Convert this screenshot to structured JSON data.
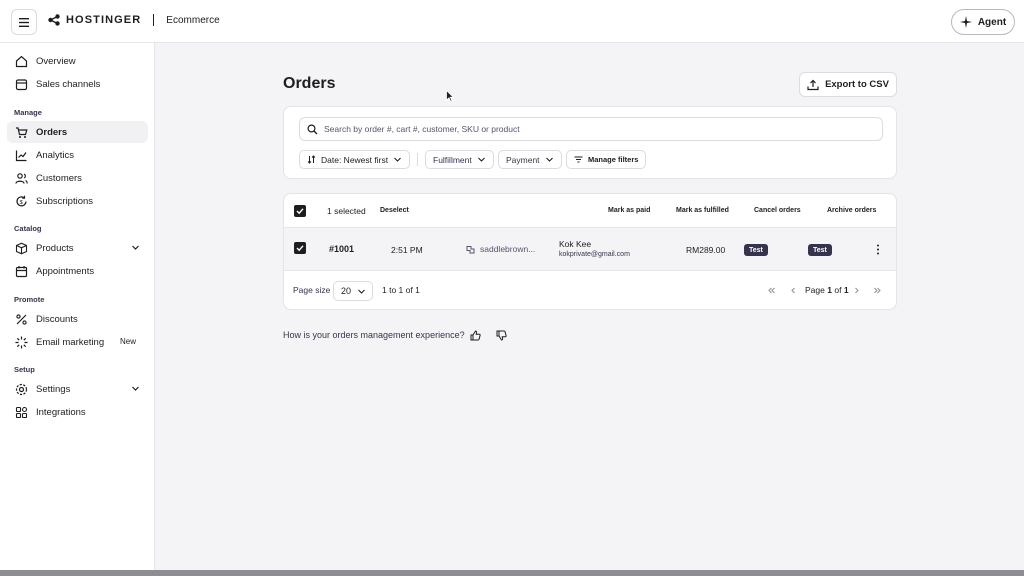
{
  "topbar": {
    "brand": "HOSTINGER",
    "product": "Ecommerce",
    "agent_label": "Agent"
  },
  "sidebar": {
    "items_top": [
      {
        "label": "Overview",
        "icon": "home-icon"
      },
      {
        "label": "Sales channels",
        "icon": "store-icon"
      }
    ],
    "section_manage": "Manage",
    "items_manage": [
      {
        "label": "Orders",
        "icon": "cart-icon",
        "active": true
      },
      {
        "label": "Analytics",
        "icon": "chart-icon"
      },
      {
        "label": "Customers",
        "icon": "users-icon"
      },
      {
        "label": "Subscriptions",
        "icon": "refresh-icon"
      }
    ],
    "section_catalog": "Catalog",
    "items_catalog": [
      {
        "label": "Products",
        "icon": "box-icon"
      },
      {
        "label": "Appointments",
        "icon": "calendar-icon"
      }
    ],
    "section_promote": "Promote",
    "items_promote": [
      {
        "label": "Discounts",
        "icon": "percent-icon"
      },
      {
        "label": "Email marketing",
        "icon": "sparkle-icon",
        "badge": "New"
      }
    ],
    "section_setup": "Setup",
    "items_setup": [
      {
        "label": "Settings",
        "icon": "gear-icon"
      },
      {
        "label": "Integrations",
        "icon": "grid-icon"
      }
    ]
  },
  "main": {
    "title": "Orders",
    "export_label": "Export to CSV",
    "search_placeholder": "Search by order #, cart #, customer, SKU or product",
    "filters": {
      "sort": "Date: Newest first",
      "fulfillment": "Fulfillment",
      "payment": "Payment",
      "manage": "Manage filters"
    },
    "bulk": {
      "selected": "1 selected",
      "deselect": "Deselect",
      "mark_paid": "Mark as paid",
      "mark_fulfilled": "Mark as fulfilled",
      "cancel": "Cancel orders",
      "archive": "Archive orders"
    },
    "orders": [
      {
        "number": "#1001",
        "time": "2:51 PM",
        "channel": "saddlebrown...",
        "customer_name": "Kok Kee",
        "customer_email": "kokprivate@gmail.com",
        "total": "RM289.00",
        "payment_status": "Test",
        "fulfillment_status": "Test"
      }
    ],
    "pager": {
      "size_label": "Page size",
      "size_value": "20",
      "range": "1 to 1 of 1",
      "page_prefix": "Page",
      "page_current": "1",
      "page_of": "of",
      "page_total": "1"
    },
    "feedback_question": "How is your orders management experience?"
  },
  "colors": {
    "accent": "#1d1e20",
    "tag_bg": "#36344d",
    "page_bg": "#f4f4f6"
  }
}
